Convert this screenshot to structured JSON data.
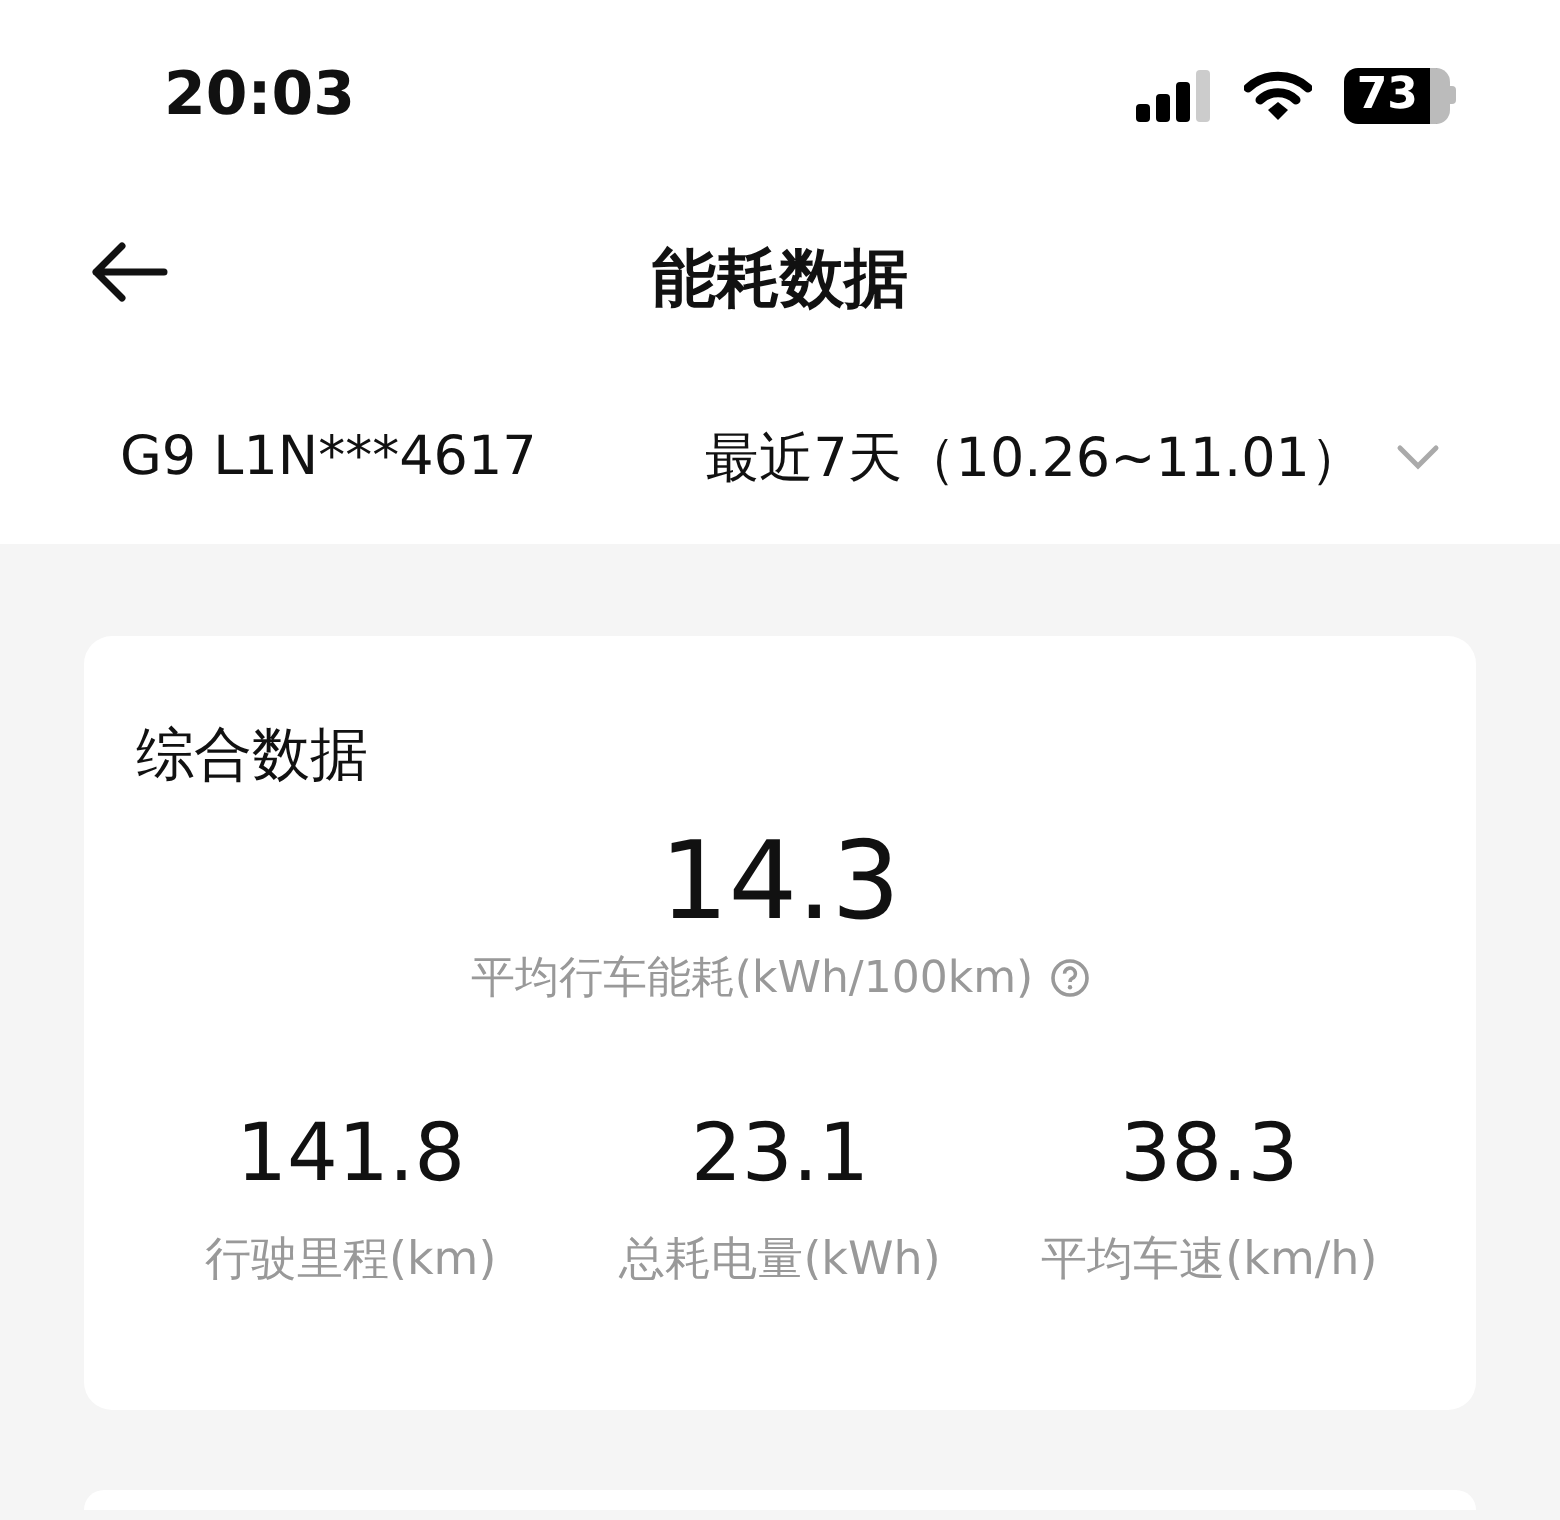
{
  "status_bar": {
    "time": "20:03",
    "battery": "73"
  },
  "header": {
    "title": "能耗数据"
  },
  "filter": {
    "vehicle": "G9 L1N***4617",
    "period": "最近7天（10.26~11.01）"
  },
  "summary": {
    "title": "综合数据",
    "main_value": "14.3",
    "main_label": "平均行车能耗(kWh/100km)",
    "stats": [
      {
        "value": "141.8",
        "label": "行驶里程(km)"
      },
      {
        "value": "23.1",
        "label": "总耗电量(kWh)"
      },
      {
        "value": "38.3",
        "label": "平均车速(km/h)"
      }
    ]
  }
}
